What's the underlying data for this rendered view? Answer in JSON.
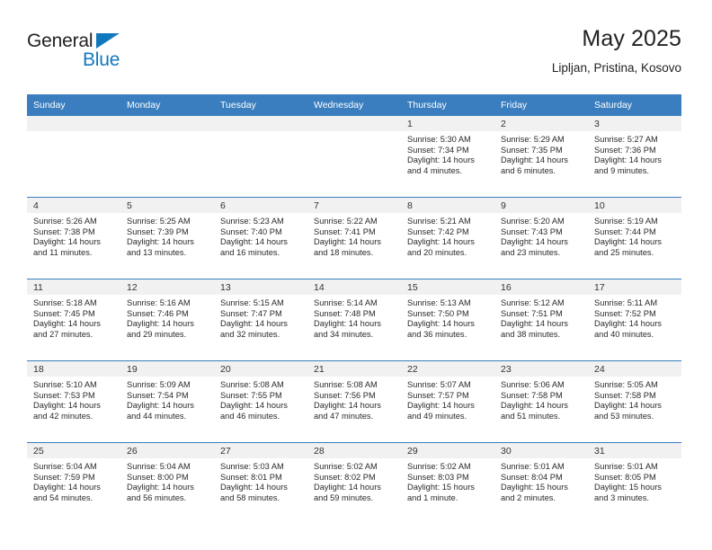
{
  "brand": {
    "name_top": "General",
    "name_bottom": "Blue",
    "triangle_color": "#1278be",
    "text_color": "#231f20"
  },
  "header": {
    "title": "May 2025",
    "subtitle": "Lipljan, Pristina, Kosovo"
  },
  "theme": {
    "header_blue": "#3a7ebf",
    "date_band_gray": "#f1f1f1",
    "text_color": "#2a2a2a"
  },
  "weekdays": [
    "Sunday",
    "Monday",
    "Tuesday",
    "Wednesday",
    "Thursday",
    "Friday",
    "Saturday"
  ],
  "weeks": [
    [
      {
        "date": "",
        "empty": true
      },
      {
        "date": "",
        "empty": true
      },
      {
        "date": "",
        "empty": true
      },
      {
        "date": "",
        "empty": true
      },
      {
        "date": "1",
        "sunrise": "Sunrise: 5:30 AM",
        "sunset": "Sunset: 7:34 PM",
        "daylight_1": "Daylight: 14 hours",
        "daylight_2": "and 4 minutes."
      },
      {
        "date": "2",
        "sunrise": "Sunrise: 5:29 AM",
        "sunset": "Sunset: 7:35 PM",
        "daylight_1": "Daylight: 14 hours",
        "daylight_2": "and 6 minutes."
      },
      {
        "date": "3",
        "sunrise": "Sunrise: 5:27 AM",
        "sunset": "Sunset: 7:36 PM",
        "daylight_1": "Daylight: 14 hours",
        "daylight_2": "and 9 minutes."
      }
    ],
    [
      {
        "date": "4",
        "sunrise": "Sunrise: 5:26 AM",
        "sunset": "Sunset: 7:38 PM",
        "daylight_1": "Daylight: 14 hours",
        "daylight_2": "and 11 minutes."
      },
      {
        "date": "5",
        "sunrise": "Sunrise: 5:25 AM",
        "sunset": "Sunset: 7:39 PM",
        "daylight_1": "Daylight: 14 hours",
        "daylight_2": "and 13 minutes."
      },
      {
        "date": "6",
        "sunrise": "Sunrise: 5:23 AM",
        "sunset": "Sunset: 7:40 PM",
        "daylight_1": "Daylight: 14 hours",
        "daylight_2": "and 16 minutes."
      },
      {
        "date": "7",
        "sunrise": "Sunrise: 5:22 AM",
        "sunset": "Sunset: 7:41 PM",
        "daylight_1": "Daylight: 14 hours",
        "daylight_2": "and 18 minutes."
      },
      {
        "date": "8",
        "sunrise": "Sunrise: 5:21 AM",
        "sunset": "Sunset: 7:42 PM",
        "daylight_1": "Daylight: 14 hours",
        "daylight_2": "and 20 minutes."
      },
      {
        "date": "9",
        "sunrise": "Sunrise: 5:20 AM",
        "sunset": "Sunset: 7:43 PM",
        "daylight_1": "Daylight: 14 hours",
        "daylight_2": "and 23 minutes."
      },
      {
        "date": "10",
        "sunrise": "Sunrise: 5:19 AM",
        "sunset": "Sunset: 7:44 PM",
        "daylight_1": "Daylight: 14 hours",
        "daylight_2": "and 25 minutes."
      }
    ],
    [
      {
        "date": "11",
        "sunrise": "Sunrise: 5:18 AM",
        "sunset": "Sunset: 7:45 PM",
        "daylight_1": "Daylight: 14 hours",
        "daylight_2": "and 27 minutes."
      },
      {
        "date": "12",
        "sunrise": "Sunrise: 5:16 AM",
        "sunset": "Sunset: 7:46 PM",
        "daylight_1": "Daylight: 14 hours",
        "daylight_2": "and 29 minutes."
      },
      {
        "date": "13",
        "sunrise": "Sunrise: 5:15 AM",
        "sunset": "Sunset: 7:47 PM",
        "daylight_1": "Daylight: 14 hours",
        "daylight_2": "and 32 minutes."
      },
      {
        "date": "14",
        "sunrise": "Sunrise: 5:14 AM",
        "sunset": "Sunset: 7:48 PM",
        "daylight_1": "Daylight: 14 hours",
        "daylight_2": "and 34 minutes."
      },
      {
        "date": "15",
        "sunrise": "Sunrise: 5:13 AM",
        "sunset": "Sunset: 7:50 PM",
        "daylight_1": "Daylight: 14 hours",
        "daylight_2": "and 36 minutes."
      },
      {
        "date": "16",
        "sunrise": "Sunrise: 5:12 AM",
        "sunset": "Sunset: 7:51 PM",
        "daylight_1": "Daylight: 14 hours",
        "daylight_2": "and 38 minutes."
      },
      {
        "date": "17",
        "sunrise": "Sunrise: 5:11 AM",
        "sunset": "Sunset: 7:52 PM",
        "daylight_1": "Daylight: 14 hours",
        "daylight_2": "and 40 minutes."
      }
    ],
    [
      {
        "date": "18",
        "sunrise": "Sunrise: 5:10 AM",
        "sunset": "Sunset: 7:53 PM",
        "daylight_1": "Daylight: 14 hours",
        "daylight_2": "and 42 minutes."
      },
      {
        "date": "19",
        "sunrise": "Sunrise: 5:09 AM",
        "sunset": "Sunset: 7:54 PM",
        "daylight_1": "Daylight: 14 hours",
        "daylight_2": "and 44 minutes."
      },
      {
        "date": "20",
        "sunrise": "Sunrise: 5:08 AM",
        "sunset": "Sunset: 7:55 PM",
        "daylight_1": "Daylight: 14 hours",
        "daylight_2": "and 46 minutes."
      },
      {
        "date": "21",
        "sunrise": "Sunrise: 5:08 AM",
        "sunset": "Sunset: 7:56 PM",
        "daylight_1": "Daylight: 14 hours",
        "daylight_2": "and 47 minutes."
      },
      {
        "date": "22",
        "sunrise": "Sunrise: 5:07 AM",
        "sunset": "Sunset: 7:57 PM",
        "daylight_1": "Daylight: 14 hours",
        "daylight_2": "and 49 minutes."
      },
      {
        "date": "23",
        "sunrise": "Sunrise: 5:06 AM",
        "sunset": "Sunset: 7:58 PM",
        "daylight_1": "Daylight: 14 hours",
        "daylight_2": "and 51 minutes."
      },
      {
        "date": "24",
        "sunrise": "Sunrise: 5:05 AM",
        "sunset": "Sunset: 7:58 PM",
        "daylight_1": "Daylight: 14 hours",
        "daylight_2": "and 53 minutes."
      }
    ],
    [
      {
        "date": "25",
        "sunrise": "Sunrise: 5:04 AM",
        "sunset": "Sunset: 7:59 PM",
        "daylight_1": "Daylight: 14 hours",
        "daylight_2": "and 54 minutes."
      },
      {
        "date": "26",
        "sunrise": "Sunrise: 5:04 AM",
        "sunset": "Sunset: 8:00 PM",
        "daylight_1": "Daylight: 14 hours",
        "daylight_2": "and 56 minutes."
      },
      {
        "date": "27",
        "sunrise": "Sunrise: 5:03 AM",
        "sunset": "Sunset: 8:01 PM",
        "daylight_1": "Daylight: 14 hours",
        "daylight_2": "and 58 minutes."
      },
      {
        "date": "28",
        "sunrise": "Sunrise: 5:02 AM",
        "sunset": "Sunset: 8:02 PM",
        "daylight_1": "Daylight: 14 hours",
        "daylight_2": "and 59 minutes."
      },
      {
        "date": "29",
        "sunrise": "Sunrise: 5:02 AM",
        "sunset": "Sunset: 8:03 PM",
        "daylight_1": "Daylight: 15 hours",
        "daylight_2": "and 1 minute."
      },
      {
        "date": "30",
        "sunrise": "Sunrise: 5:01 AM",
        "sunset": "Sunset: 8:04 PM",
        "daylight_1": "Daylight: 15 hours",
        "daylight_2": "and 2 minutes."
      },
      {
        "date": "31",
        "sunrise": "Sunrise: 5:01 AM",
        "sunset": "Sunset: 8:05 PM",
        "daylight_1": "Daylight: 15 hours",
        "daylight_2": "and 3 minutes."
      }
    ]
  ]
}
